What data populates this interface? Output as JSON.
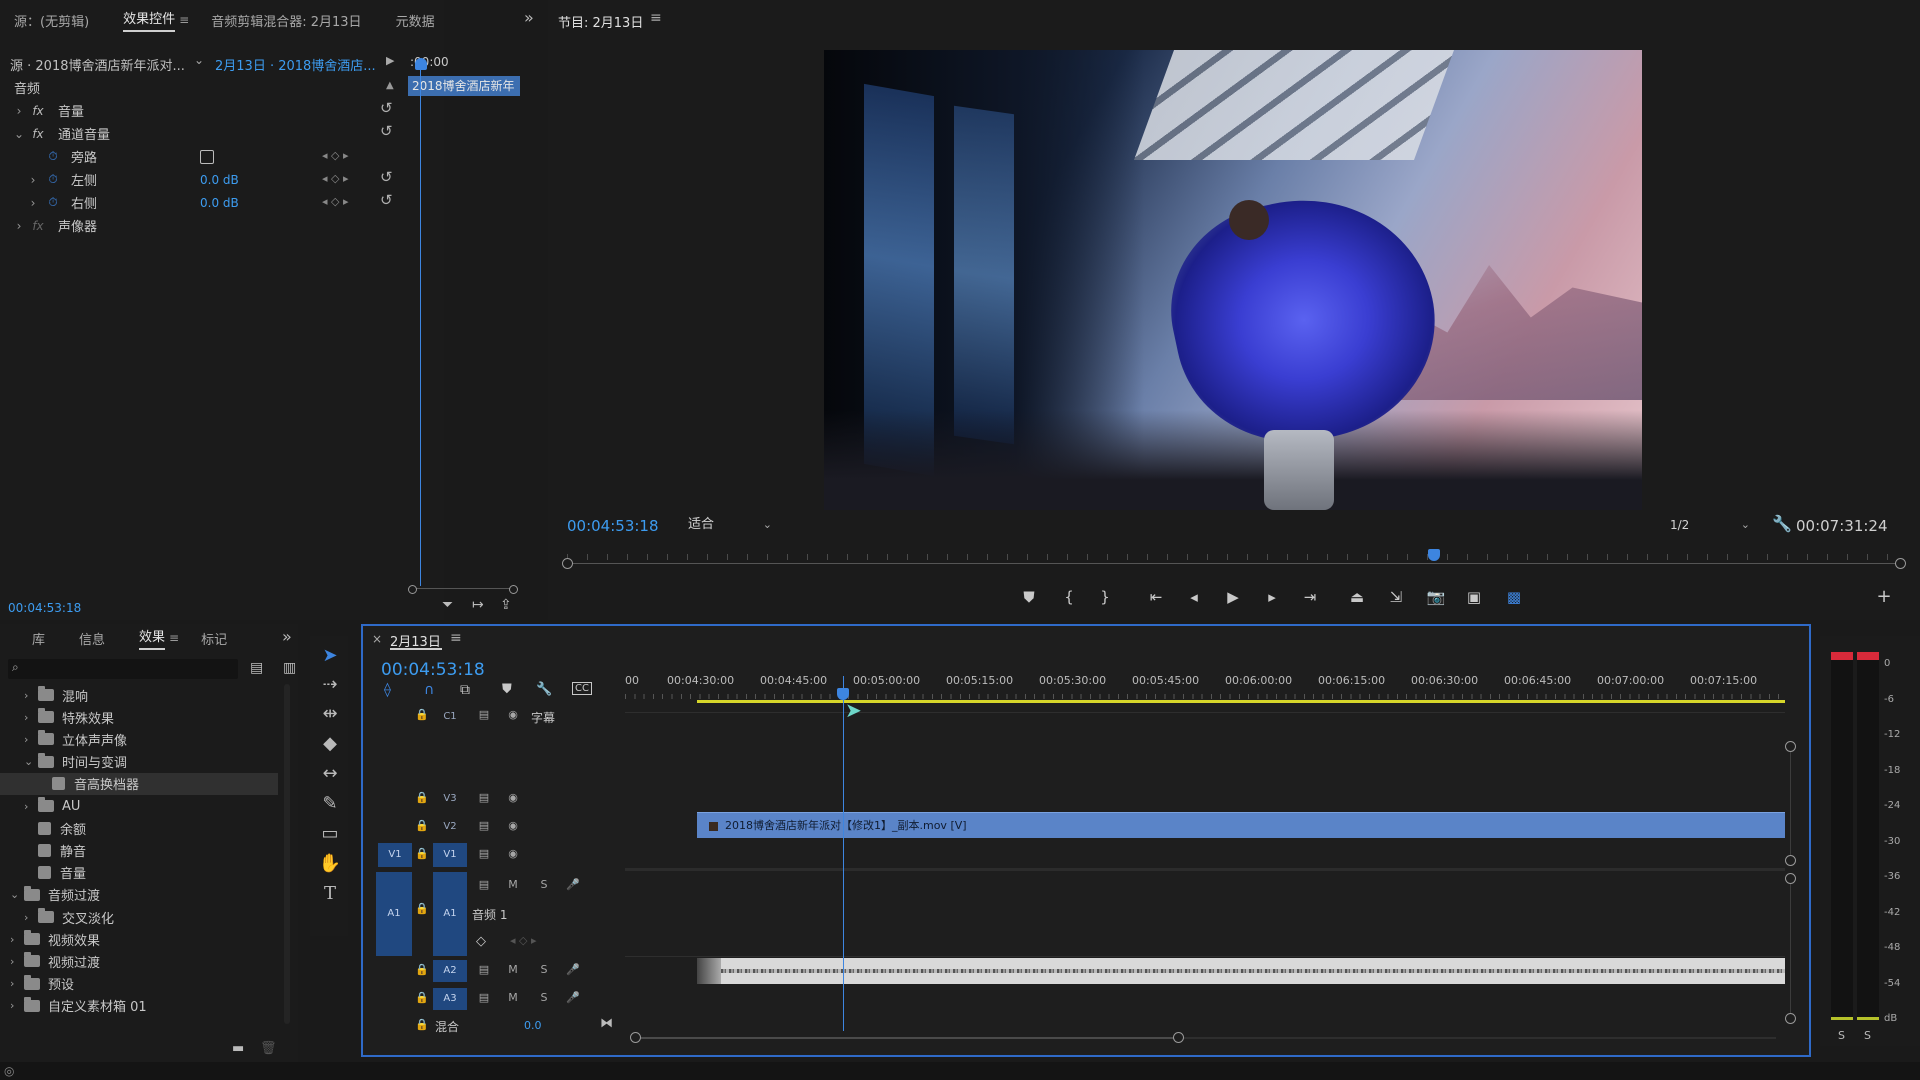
{
  "source_panel": {
    "tabs": [
      "源：(无剪辑)",
      "效果控件",
      "音频剪辑混合器: 2月13日",
      "元数据"
    ],
    "active_tab": "效果控件",
    "source_label": "源 · 2018博舍酒店新年派对...",
    "sequence_label": "2月13日 · 2018博舍酒店...",
    "ruler_time": ":00:00",
    "clip_label": "2018博舍酒店新年",
    "section_audio": "音频",
    "effects": [
      {
        "name": "音量"
      },
      {
        "name": "通道音量"
      }
    ],
    "params": [
      {
        "name": "旁路",
        "value": ""
      },
      {
        "name": "左侧",
        "value": "0.0 dB"
      },
      {
        "name": "右侧",
        "value": "0.0 dB"
      }
    ],
    "panner": "声像器",
    "timecode": "00:04:53:18"
  },
  "program_monitor": {
    "title": "节目: 2月13日",
    "timecode": "00:04:53:18",
    "fit_label": "适合",
    "resolution": "1/2",
    "duration": "00:07:31:24",
    "playhead_fraction": 0.65
  },
  "effects_panel": {
    "tabs": [
      "库",
      "信息",
      "效果",
      "标记"
    ],
    "active_tab": "效果",
    "tree": [
      {
        "label": "混响",
        "level": 1,
        "type": "folder",
        "expanded": false
      },
      {
        "label": "特殊效果",
        "level": 1,
        "type": "folder",
        "expanded": false
      },
      {
        "label": "立体声声像",
        "level": 1,
        "type": "folder",
        "expanded": false
      },
      {
        "label": "时间与变调",
        "level": 1,
        "type": "folder",
        "expanded": true
      },
      {
        "label": "音高换档器",
        "level": 2,
        "type": "fx",
        "selected": true
      },
      {
        "label": "AU",
        "level": 1,
        "type": "folder",
        "expanded": false
      },
      {
        "label": "余额",
        "level": 1,
        "type": "fx"
      },
      {
        "label": "静音",
        "level": 1,
        "type": "fx"
      },
      {
        "label": "音量",
        "level": 1,
        "type": "fx"
      },
      {
        "label": "音频过渡",
        "level": 0,
        "type": "folder",
        "expanded": true
      },
      {
        "label": "交叉淡化",
        "level": 1,
        "type": "folder",
        "expanded": false
      },
      {
        "label": "视频效果",
        "level": 0,
        "type": "folder",
        "expanded": false
      },
      {
        "label": "视频过渡",
        "level": 0,
        "type": "folder",
        "expanded": false
      },
      {
        "label": "预设",
        "level": 0,
        "type": "folder",
        "expanded": false
      },
      {
        "label": "自定义素材箱 01",
        "level": 0,
        "type": "folder",
        "expanded": false
      }
    ]
  },
  "timeline": {
    "title": "2月13日",
    "timecode": "00:04:53:18",
    "ruler": [
      "00",
      "00:04:30:00",
      "00:04:45:00",
      "00:05:00:00",
      "00:05:15:00",
      "00:05:30:00",
      "00:05:45:00",
      "00:06:00:00",
      "00:06:15:00",
      "00:06:30:00",
      "00:06:45:00",
      "00:07:00:00",
      "00:07:15:00"
    ],
    "tracks": {
      "c1": "C1",
      "caption": "字幕",
      "v3": "V3",
      "v2": "V2",
      "v1": "V1",
      "v1_src": "V1",
      "a1": "A1",
      "a1_src": "A1",
      "a1_name": "音频 1",
      "a2": "A2",
      "a3": "A3",
      "mix": "混合",
      "mix_value": "0.0"
    },
    "m": "M",
    "s": "S",
    "video_clip": "2018博舍酒店新年派对【修改1】_副本.mov [V]"
  },
  "meter": {
    "labels": [
      "0",
      "-6",
      "-12",
      "-18",
      "-24",
      "-30",
      "-36",
      "-42",
      "-48",
      "-54",
      "dB"
    ],
    "solo": [
      "S",
      "S"
    ]
  }
}
